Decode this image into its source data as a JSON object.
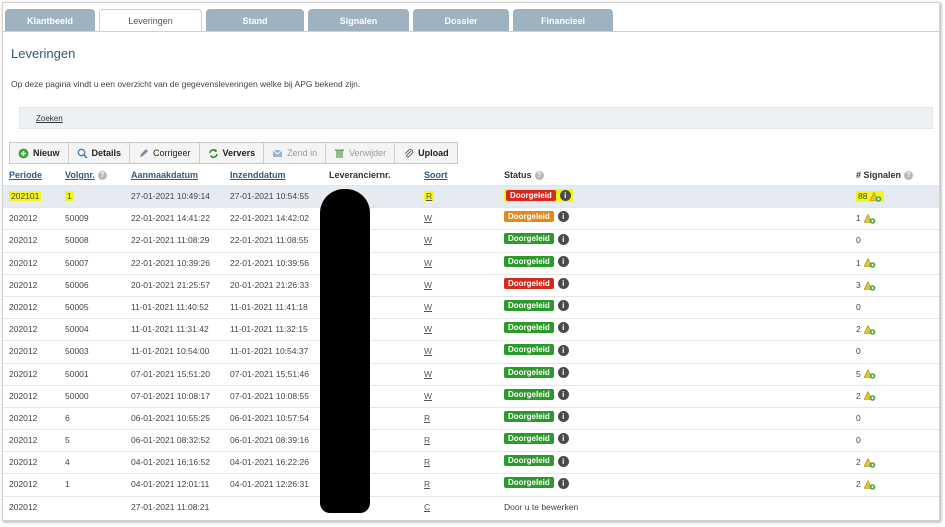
{
  "tabs": [
    {
      "label": "Klantbeeld",
      "active": false
    },
    {
      "label": "Leveringen",
      "active": true
    },
    {
      "label": "Stand",
      "active": false
    },
    {
      "label": "Signalen",
      "active": false
    },
    {
      "label": "Dossier",
      "active": false
    },
    {
      "label": "Financieel",
      "active": false
    }
  ],
  "page": {
    "title": "Leveringen",
    "intro": "Op deze pagina vindt u een overzicht van de gegevensleveringen welke bij APG bekend zijn.",
    "search_label": "Zoeken"
  },
  "toolbar": {
    "nieuw": "Nieuw",
    "details": "Details",
    "corrigeer": "Corrigeer",
    "ververs": "Ververs",
    "zendin": "Zend in",
    "verwijder": "Verwijder",
    "upload": "Upload"
  },
  "columns": {
    "periode": "Periode",
    "volgnr": "Volgnr.",
    "aanmaakdatum": "Aanmaakdatum",
    "inzenddatum": "Inzenddatum",
    "leveranciernr": "Leveranciernr.",
    "soort": "Soort",
    "status": "Status",
    "signalen": "# Signalen"
  },
  "colors": {
    "status_green": "#2a9a2a",
    "status_orange": "#e08a1c",
    "status_red": "#d42a1e",
    "highlight": "#f5f519",
    "title_blue": "#2d5b86"
  },
  "rows": [
    {
      "periode": "202101",
      "volgnr": "1",
      "aanmaak": "27-01-2021 10:49:14",
      "inzend": "27-01-2021 10:54:55",
      "soort": "R",
      "status": "Doorgeleid",
      "status_color": "red",
      "signalen": "88",
      "signal_icon": true,
      "highlight": true
    },
    {
      "periode": "202012",
      "volgnr": "50009",
      "aanmaak": "22-01-2021 14:41:22",
      "inzend": "22-01-2021 14:42:02",
      "soort": "W",
      "status": "Doorgeleid",
      "status_color": "orange",
      "signalen": "1",
      "signal_icon": true
    },
    {
      "periode": "202012",
      "volgnr": "50008",
      "aanmaak": "22-01-2021 11:08:29",
      "inzend": "22-01-2021 11:08:55",
      "soort": "W",
      "status": "Doorgeleid",
      "status_color": "green",
      "signalen": "0",
      "signal_icon": false
    },
    {
      "periode": "202012",
      "volgnr": "50007",
      "aanmaak": "22-01-2021 10:39:26",
      "inzend": "22-01-2021 10:39:56",
      "soort": "W",
      "status": "Doorgeleid",
      "status_color": "green",
      "signalen": "1",
      "signal_icon": true
    },
    {
      "periode": "202012",
      "volgnr": "50006",
      "aanmaak": "20-01-2021 21:25:57",
      "inzend": "20-01-2021 21:26:33",
      "soort": "W",
      "status": "Doorgeleid",
      "status_color": "red",
      "signalen": "3",
      "signal_icon": true
    },
    {
      "periode": "202012",
      "volgnr": "50005",
      "aanmaak": "11-01-2021 11:40:52",
      "inzend": "11-01-2021 11:41:18",
      "soort": "W",
      "status": "Doorgeleid",
      "status_color": "green",
      "signalen": "0",
      "signal_icon": false
    },
    {
      "periode": "202012",
      "volgnr": "50004",
      "aanmaak": "11-01-2021 11:31:42",
      "inzend": "11-01-2021 11:32:15",
      "soort": "W",
      "status": "Doorgeleid",
      "status_color": "green",
      "signalen": "2",
      "signal_icon": true
    },
    {
      "periode": "202012",
      "volgnr": "50003",
      "aanmaak": "11-01-2021 10:54:00",
      "inzend": "11-01-2021 10:54:37",
      "soort": "W",
      "status": "Doorgeleid",
      "status_color": "green",
      "signalen": "0",
      "signal_icon": false
    },
    {
      "periode": "202012",
      "volgnr": "50001",
      "aanmaak": "07-01-2021 15:51:20",
      "inzend": "07-01-2021 15:51:46",
      "soort": "W",
      "status": "Doorgeleid",
      "status_color": "green",
      "signalen": "5",
      "signal_icon": true
    },
    {
      "periode": "202012",
      "volgnr": "50000",
      "aanmaak": "07-01-2021 10:08:17",
      "inzend": "07-01-2021 10:08:55",
      "soort": "W",
      "status": "Doorgeleid",
      "status_color": "green",
      "signalen": "2",
      "signal_icon": true
    },
    {
      "periode": "202012",
      "volgnr": "6",
      "aanmaak": "06-01-2021 10:55:25",
      "inzend": "06-01-2021 10:57:54",
      "soort": "R",
      "status": "Doorgeleid",
      "status_color": "green",
      "signalen": "0",
      "signal_icon": false
    },
    {
      "periode": "202012",
      "volgnr": "5",
      "aanmaak": "06-01-2021 08:32:52",
      "inzend": "06-01-2021 08:39:16",
      "soort": "R",
      "status": "Doorgeleid",
      "status_color": "green",
      "signalen": "0",
      "signal_icon": false
    },
    {
      "periode": "202012",
      "volgnr": "4",
      "aanmaak": "04-01-2021 16:16:52",
      "inzend": "04-01-2021 16:22:26",
      "soort": "R",
      "status": "Doorgeleid",
      "status_color": "green",
      "signalen": "2",
      "signal_icon": true
    },
    {
      "periode": "202012",
      "volgnr": "1",
      "aanmaak": "04-01-2021 12:01:11",
      "inzend": "04-01-2021 12:26:31",
      "soort": "R",
      "status": "Doorgeleid",
      "status_color": "green",
      "signalen": "2",
      "signal_icon": true
    },
    {
      "periode": "202012",
      "volgnr": "",
      "aanmaak": "27-01-2021 11:08:21",
      "inzend": "",
      "soort": "C",
      "status": "Door u te bewerken",
      "status_color": "none",
      "signalen": "",
      "signal_icon": false
    }
  ]
}
